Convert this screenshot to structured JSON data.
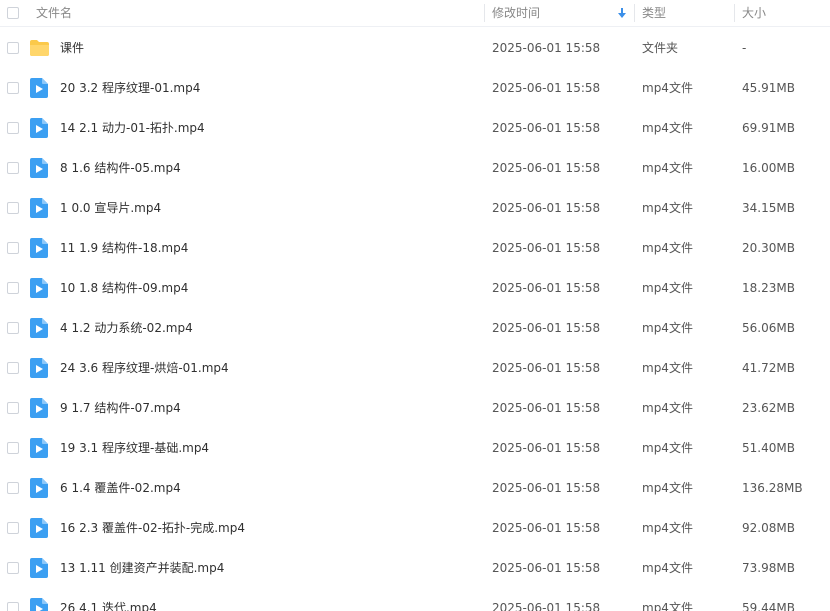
{
  "colors": {
    "folder": "#fbc94a",
    "video": "#3b9ff2",
    "accent": "#3b8fe9"
  },
  "header": {
    "name_label": "文件名",
    "time_label": "修改时间",
    "type_label": "类型",
    "size_label": "大小",
    "sort_icon": "arrow-down-icon"
  },
  "files": [
    {
      "icon": "folder-icon",
      "name": "课件",
      "time": "2025-06-01 15:58",
      "type": "文件夹",
      "size": "-"
    },
    {
      "icon": "video-icon",
      "name": "20 3.2 程序纹理-01.mp4",
      "time": "2025-06-01 15:58",
      "type": "mp4文件",
      "size": "45.91MB"
    },
    {
      "icon": "video-icon",
      "name": "14 2.1 动力-01-拓扑.mp4",
      "time": "2025-06-01 15:58",
      "type": "mp4文件",
      "size": "69.91MB"
    },
    {
      "icon": "video-icon",
      "name": "8 1.6 结构件-05.mp4",
      "time": "2025-06-01 15:58",
      "type": "mp4文件",
      "size": "16.00MB"
    },
    {
      "icon": "video-icon",
      "name": "1 0.0 宣导片.mp4",
      "time": "2025-06-01 15:58",
      "type": "mp4文件",
      "size": "34.15MB"
    },
    {
      "icon": "video-icon",
      "name": "11 1.9 结构件-18.mp4",
      "time": "2025-06-01 15:58",
      "type": "mp4文件",
      "size": "20.30MB"
    },
    {
      "icon": "video-icon",
      "name": "10 1.8 结构件-09.mp4",
      "time": "2025-06-01 15:58",
      "type": "mp4文件",
      "size": "18.23MB"
    },
    {
      "icon": "video-icon",
      "name": "4 1.2 动力系统-02.mp4",
      "time": "2025-06-01 15:58",
      "type": "mp4文件",
      "size": "56.06MB"
    },
    {
      "icon": "video-icon",
      "name": "24 3.6 程序纹理-烘焙-01.mp4",
      "time": "2025-06-01 15:58",
      "type": "mp4文件",
      "size": "41.72MB"
    },
    {
      "icon": "video-icon",
      "name": "9 1.7 结构件-07.mp4",
      "time": "2025-06-01 15:58",
      "type": "mp4文件",
      "size": "23.62MB"
    },
    {
      "icon": "video-icon",
      "name": "19 3.1 程序纹理-基础.mp4",
      "time": "2025-06-01 15:58",
      "type": "mp4文件",
      "size": "51.40MB"
    },
    {
      "icon": "video-icon",
      "name": "6 1.4 覆盖件-02.mp4",
      "time": "2025-06-01 15:58",
      "type": "mp4文件",
      "size": "136.28MB"
    },
    {
      "icon": "video-icon",
      "name": "16 2.3 覆盖件-02-拓扑-完成.mp4",
      "time": "2025-06-01 15:58",
      "type": "mp4文件",
      "size": "92.08MB"
    },
    {
      "icon": "video-icon",
      "name": "13 1.11 创建资产并装配.mp4",
      "time": "2025-06-01 15:58",
      "type": "mp4文件",
      "size": "73.98MB"
    },
    {
      "icon": "video-icon",
      "name": "26 4.1 迭代.mp4",
      "time": "2025-06-01 15:58",
      "type": "mp4文件",
      "size": "59.44MB"
    }
  ]
}
